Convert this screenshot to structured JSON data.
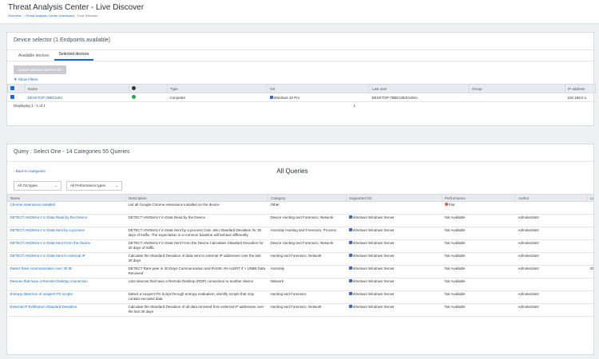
{
  "header": {
    "title": "Threat Analysis Center - Live Discover",
    "breadcrumb": [
      "Overview",
      "Threat Analysis Center Dashboard",
      "Live Discover"
    ]
  },
  "device_panel": {
    "title": "Device selector (1 Endpoints available)",
    "tabs": [
      "Available devices",
      "Selected devices"
    ],
    "active_tab": "Selected devices",
    "update_button": "Update selected devices list",
    "filters_link": "Show Filters",
    "columns": [
      "Name",
      "",
      "Type",
      "OS",
      "Last user",
      "Group",
      "IP address"
    ],
    "rows": [
      {
        "name": "DESKTOP-7BBCUB3",
        "type": "Computer",
        "os": "Windows 10 Pro",
        "last_user": "DESKTOP-7BBCUB3\\Admin",
        "group": "",
        "ip": "192.168.0.1"
      }
    ],
    "displaying": "Displaying 1 - 1 of 1",
    "page": "1"
  },
  "query_panel": {
    "title": "Query : Select One - 14 Categories 55 Queries",
    "back_link": "Back to categories",
    "heading": "All Queries",
    "os_select": "All OS types",
    "perf_select": "All Performance types",
    "columns": [
      "Name",
      "Description",
      "Category",
      "Supported OS",
      "Performance",
      "Author",
      "Last"
    ],
    "rows": [
      {
        "name": "Chrome extensions installed",
        "desc": "List all Google Chrome extensions installed on the device",
        "category": "Other",
        "os": "",
        "perf": "Fair",
        "author": "",
        "last": ""
      },
      {
        "name": "DETECT ANOMALY in Data Read by the Device",
        "desc": "DETECT ANOMALY in Data Read by the Device",
        "category": "Device Hunting and Forensics, Network",
        "os": "Windows  Windows Server",
        "perf": "Not Available",
        "author": "Administrator",
        "last": ""
      },
      {
        "name": "DETECT ANOMALY in Data Sent by a process",
        "desc": "DETECT ANOMALY in Data Sent by a process Calc. also Standard Deviation for 30 days of traffic. The expectation is a common baseline will behave differently.",
        "category": "Anomaly Hunting and Forensics, Process",
        "os": "Windows  Windows Server",
        "perf": "Not Available",
        "author": "Administrator",
        "last": ""
      },
      {
        "name": "DETECT ANOMALY in Data Sent From the Device",
        "desc": "DETECT ANOMALY in Data Sent From the Device Calculates Standard Deviation for 30 days of traffic",
        "category": "Device Hunting and Forensics, Network",
        "os": "Windows  Windows Server",
        "perf": "Not Available",
        "author": "Administrator",
        "last": ""
      },
      {
        "name": "DETECT ANOMALY in Data Sent to external IP",
        "desc": "Calculate the Standard Deviation of data sent to external IP addresses over the last 30 days",
        "category": "Hunting and Forensics, Network",
        "os": "Windows  Windows Server",
        "perf": "Not Available",
        "author": "Administrator",
        "last": ""
      },
      {
        "name": "Detect Rare communication over 30 IB",
        "desc": "DETECT Rare peer in 30 Days Communication and RAISE AN ALERT if > 10MB Data Received",
        "category": "Anomaly",
        "os": "Windows  Windows Server",
        "perf": "Not Available",
        "author": "Administrator",
        "last": "202"
      },
      {
        "name": "Devices that have a Remote Desktop connection",
        "desc": "Lists devices that have a Remote Desktop (RDP) connection to another device",
        "category": "Network",
        "os": "Windows  Windows Server",
        "perf": "Not Available",
        "author": "",
        "last": ""
      },
      {
        "name": "Entropy detection of suspect PS scripts",
        "desc": "Detect a suspect PS Script through entropy evaluation; identify scripts that may contain encoded data",
        "category": "Hunting and Forensics",
        "os": "Windows  Windows Server",
        "perf": "Not Available",
        "author": "Administrator",
        "last": ""
      },
      {
        "name": "External IP Exfiltration Standard Deviation",
        "desc": "Calculate the Standard Deviation of all data received from external IP addresses over the last 30 days",
        "category": "Hunting and Forensics, Network",
        "os": "Windows  Windows Server",
        "perf": "Not Available",
        "author": "Administrator",
        "last": ""
      }
    ]
  }
}
